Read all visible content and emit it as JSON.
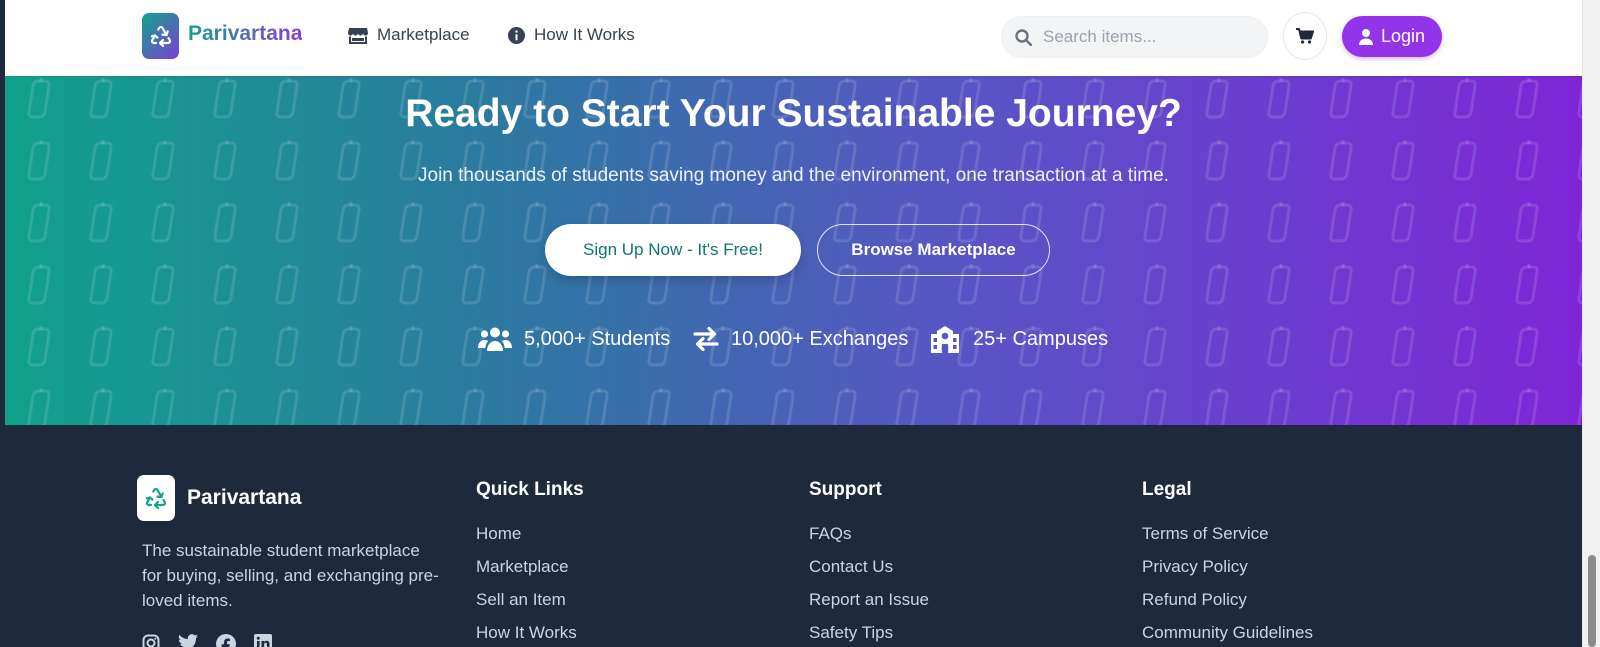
{
  "header": {
    "brand": "Parivartana",
    "nav": [
      {
        "label": "Marketplace",
        "icon": "store-icon"
      },
      {
        "label": "How It Works",
        "icon": "info-circle-icon"
      }
    ],
    "search_placeholder": "Search items...",
    "cart_icon": "cart-icon",
    "login_label": "Login",
    "accent_color": "#9333ea"
  },
  "hero": {
    "title": "Ready to Start Your Sustainable Journey?",
    "subtitle": "Join thousands of students saving money and the environment, one transaction at a time.",
    "primary_button": "Sign Up Now - It's Free!",
    "secondary_button": "Browse Marketplace",
    "stats": [
      {
        "icon": "users-icon",
        "label": "5,000+ Students"
      },
      {
        "icon": "exchange-icon",
        "label": "10,000+ Exchanges"
      },
      {
        "icon": "school-icon",
        "label": "25+ Campuses"
      }
    ],
    "gradient_start": "#10a28b",
    "gradient_end": "#7e26d6"
  },
  "footer": {
    "brand": "Parivartana",
    "description": "The sustainable student marketplace for buying, selling, and exchanging pre-loved items.",
    "socials": [
      "instagram-icon",
      "twitter-icon",
      "facebook-icon",
      "linkedin-icon"
    ],
    "columns": [
      {
        "title": "Quick Links",
        "links": [
          "Home",
          "Marketplace",
          "Sell an Item",
          "How It Works"
        ]
      },
      {
        "title": "Support",
        "links": [
          "FAQs",
          "Contact Us",
          "Report an Issue",
          "Safety Tips"
        ]
      },
      {
        "title": "Legal",
        "links": [
          "Terms of Service",
          "Privacy Policy",
          "Refund Policy",
          "Community Guidelines"
        ]
      }
    ],
    "background": "#1e293b"
  }
}
